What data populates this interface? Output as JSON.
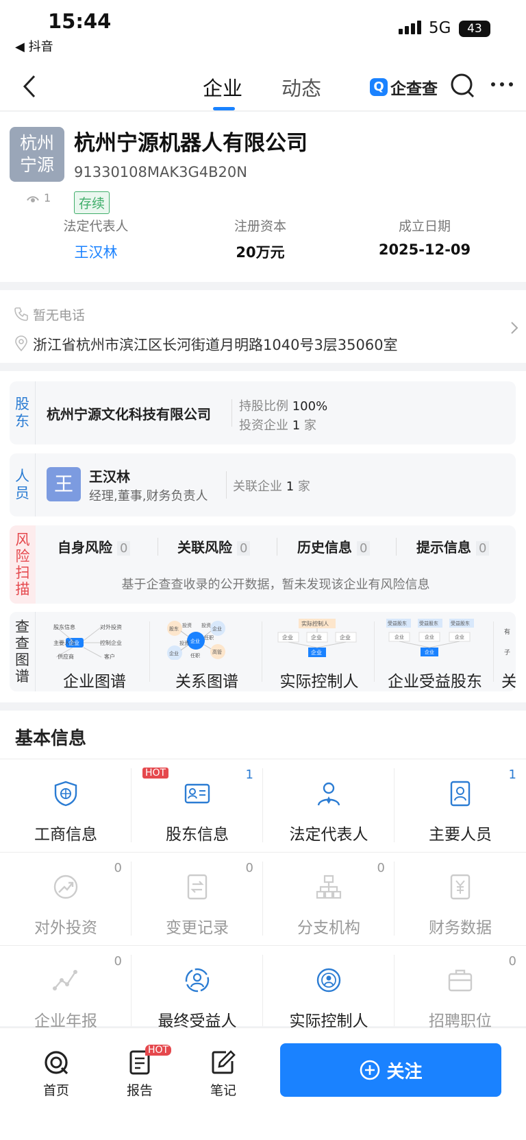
{
  "status_bar": {
    "time": "15:44",
    "back_app": "◀ 抖音",
    "network": "5G",
    "battery": "43"
  },
  "nav": {
    "tab_company": "企业",
    "tab_dynamic": "动态",
    "brand": "企查查"
  },
  "company": {
    "logo_line1": "杭州",
    "logo_line2": "宁源",
    "name": "杭州宁源机器人有限公司",
    "credit_code": "91330108MAK3G4B20N",
    "status": "存续",
    "view_count": "1",
    "legal_rep_label": "法定代表人",
    "legal_rep": "王汉林",
    "capital_label": "注册资本",
    "capital": "20万元",
    "founded_label": "成立日期",
    "founded": "2025-12-09"
  },
  "contact": {
    "phone": "暂无电话",
    "address": "浙江省杭州市滨江区长河街道月明路1040号3层35060室"
  },
  "shareholder": {
    "label_1": "股",
    "label_2": "东",
    "name": "杭州宁源文化科技有限公司",
    "ratio_label": "持股比例",
    "ratio": "100%",
    "invest_label": "投资企业",
    "invest_count": "1",
    "unit": "家"
  },
  "personnel": {
    "label_1": "人",
    "label_2": "员",
    "avatar": "王",
    "name": "王汉林",
    "roles": "经理,董事,财务负责人",
    "related_label": "关联企业",
    "related_count": "1",
    "unit": "家"
  },
  "risk": {
    "label": [
      "风",
      "险",
      "扫",
      "描"
    ],
    "items": [
      {
        "label": "自身风险",
        "count": "0"
      },
      {
        "label": "关联风险",
        "count": "0"
      },
      {
        "label": "历史信息",
        "count": "0"
      },
      {
        "label": "提示信息",
        "count": "0"
      }
    ],
    "note": "基于企查查收录的公开数据，暂未发现该企业有风险信息"
  },
  "graph": {
    "label": [
      "查",
      "查",
      "图",
      "谱"
    ],
    "items": [
      {
        "label": "企业图谱",
        "nodes": [
          "股东信息",
          "对外投资",
          "主要人员",
          "企业",
          "控制企业",
          "供应商",
          "客户"
        ]
      },
      {
        "label": "关系图谱",
        "nodes": [
          "股东",
          "投资",
          "企业",
          "投资",
          "企业",
          "任职",
          "企业",
          "高管",
          "投资",
          "任职"
        ]
      },
      {
        "label": "实际控制人",
        "nodes": [
          "实际控制人",
          "企业",
          "企业",
          "企业",
          "企业"
        ]
      },
      {
        "label": "企业受益股东",
        "nodes": [
          "受益股东",
          "受益股东",
          "受益股东",
          "企业",
          "企业",
          "企业",
          "企业"
        ]
      },
      {
        "label": "关联",
        "nodes": [
          "有",
          "子"
        ]
      }
    ]
  },
  "basic": {
    "title": "基本信息",
    "hot": "HOT",
    "items": [
      {
        "label": "工商信息",
        "count": ""
      },
      {
        "label": "股东信息",
        "count": "1"
      },
      {
        "label": "法定代表人",
        "count": ""
      },
      {
        "label": "主要人员",
        "count": "1"
      },
      {
        "label": "对外投资",
        "count": "0"
      },
      {
        "label": "变更记录",
        "count": "0"
      },
      {
        "label": "分支机构",
        "count": "0"
      },
      {
        "label": "财务数据",
        "count": ""
      },
      {
        "label": "企业年报",
        "count": "0"
      },
      {
        "label": "最终受益人",
        "count": ""
      },
      {
        "label": "实际控制人",
        "count": ""
      },
      {
        "label": "招聘职位",
        "count": "0"
      }
    ]
  },
  "bottom": {
    "home": "首页",
    "report": "报告",
    "note": "笔记",
    "hot": "HOT",
    "follow": "关注"
  },
  "colors": {
    "accent": "#1a82ff",
    "risk_red": "#e5484d",
    "label_blue": "#2b7cd3"
  }
}
